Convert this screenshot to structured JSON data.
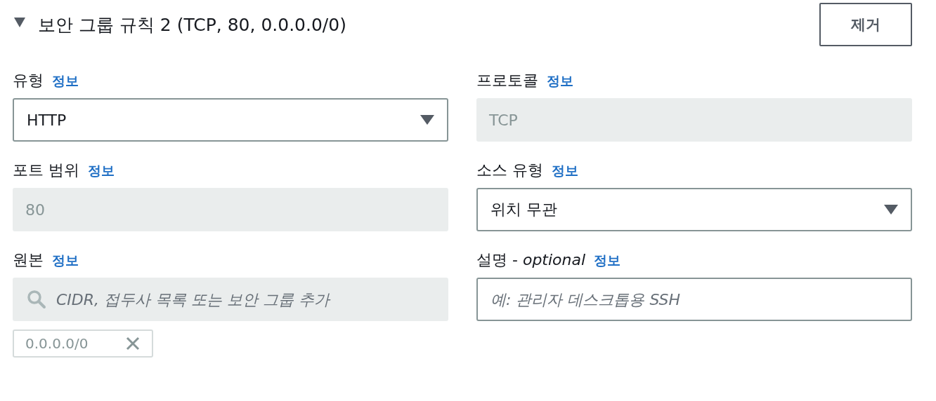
{
  "rule": {
    "title": "보안 그룹 규칙 2 (TCP, 80, 0.0.0.0/0)",
    "expanded": true,
    "remove_button": "제거"
  },
  "fields": [
    {
      "label": "유형",
      "info": "정보",
      "kind": "select",
      "value": "HTTP"
    },
    {
      "label": "프로토콜",
      "info": "정보",
      "kind": "readonly",
      "value": "TCP"
    },
    {
      "label": "포트 범위",
      "info": "정보",
      "kind": "readonly",
      "value": "80"
    },
    {
      "label": "소스 유형",
      "info": "정보",
      "kind": "select",
      "value": "위치 무관"
    },
    {
      "label": "원본",
      "info": "정보",
      "kind": "search",
      "placeholder": "CIDR, 접두사 목록 또는 보안 그룹 추가",
      "tokens": [
        {
          "value": "0.0.0.0/0"
        }
      ]
    },
    {
      "label": "설명 - *optional*",
      "info": "정보",
      "kind": "text",
      "placeholder": "예: 관리자 데스크톱용 SSH"
    }
  ]
}
